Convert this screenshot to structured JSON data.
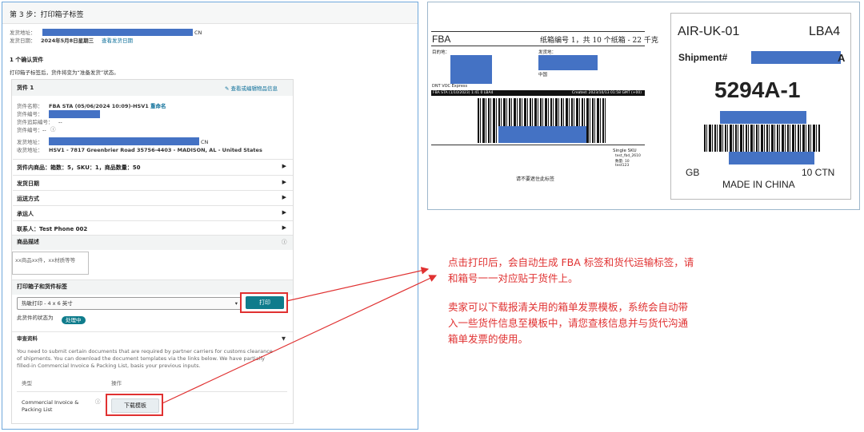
{
  "step_title": "第 3 步：打印箱子标签",
  "ship_from_label": "发货地址：",
  "ship_from_suffix": "CN",
  "ship_date_label": "发货日期：",
  "ship_date_value": "2024年5月8日星期三",
  "ship_date_link": "查看发货日期",
  "confirmed_heading": "1 个确认货件",
  "confirmed_note": "打印箱子标签后，货件将变为“准备发货”状态。",
  "shipment": {
    "title": "货件 1",
    "view_edit_link": "查看或编辑物品信息",
    "name_label": "货件名称：",
    "name_value": "FBA STA (05/06/2024 10:09)-HSV1",
    "rename_link": "重命名",
    "id_label": "货件编号：",
    "tracking_label": "货件追踪编号：",
    "tracking_value": "--",
    "ref_label": "货件编号：",
    "ref_value": "--",
    "from_label": "发货地址：",
    "from_suffix": "CN",
    "to_label": "收货地址：",
    "to_value": "HSV1 - 7817 Greenbrier Road 35756-4403 - MADISON, AL - United States"
  },
  "contents_row": "货件内商品：箱数：5，SKU：1，商品数量：50",
  "sections": [
    "发货日期",
    "运送方式",
    "承运人",
    "联系人：Test Phone 002"
  ],
  "description": {
    "title": "商品描述",
    "placeholder": "xx商品xx件，xx材质等等"
  },
  "print": {
    "title": "打印箱子和货件标签",
    "select_value": "热敏打印 - 4 x 6 英寸",
    "button": "打印",
    "status_label": "此货件的状态为",
    "status_badge": "处理中"
  },
  "review": {
    "title": "审查资料",
    "text": [
      "You need to submit certain documents that are required by partner carriers for customs clearance",
      "of shipments. You can download the document templates via the links below. We have partially",
      "filled-in Commercial Invoice & Packing List, basis your previous inputs."
    ],
    "col_type": "类型",
    "col_action": "操作",
    "doc_name_1": "Commercial Invoice &",
    "doc_name_2": "Packing List",
    "download_button": "下载模板"
  },
  "fba_label": {
    "brand": "FBA",
    "box_info": "纸箱编号 1，共 10 个纸箱 - 22 千克",
    "dest_label": "目的地：",
    "from_label": "发货地：",
    "from_country": "中国",
    "dest_code": "DNT VOC Express",
    "strip_left": "FBA STA (1/10/2023) 1:41 0 LBA4",
    "strip_right": "Created: 2023/10/13 01:58 GMT (+00)",
    "sku_heading": "Single SKU",
    "sku_lines": [
      "test_fbd_2610",
      "数量: 10",
      "test123"
    ],
    "footer": "请不要遮住此标签"
  },
  "carrier_label": {
    "route": "AIR-UK-01",
    "code": "LBA4",
    "shipment_label": "Shipment#",
    "shipment_suffix": "A",
    "box_number": "5294A-1",
    "country": "GB",
    "cartons": "10 CTN",
    "origin": "MADE IN CHINA"
  },
  "notes": {
    "line1": "点击打印后，会自动生成 FBA 标签和货代运输标签，请",
    "line2": "和箱号一一对应贴于货件上。",
    "line3": "卖家可以下载报清关用的箱单发票模板，系统会自动带",
    "line4": "入一些货件信息至模板中，请您查核信息并与货代沟通",
    "line5": "箱单发票的使用。"
  },
  "colors": {
    "accent": "#0f7c8c",
    "redaction": "#4472c4",
    "annotation": "#e03131"
  }
}
